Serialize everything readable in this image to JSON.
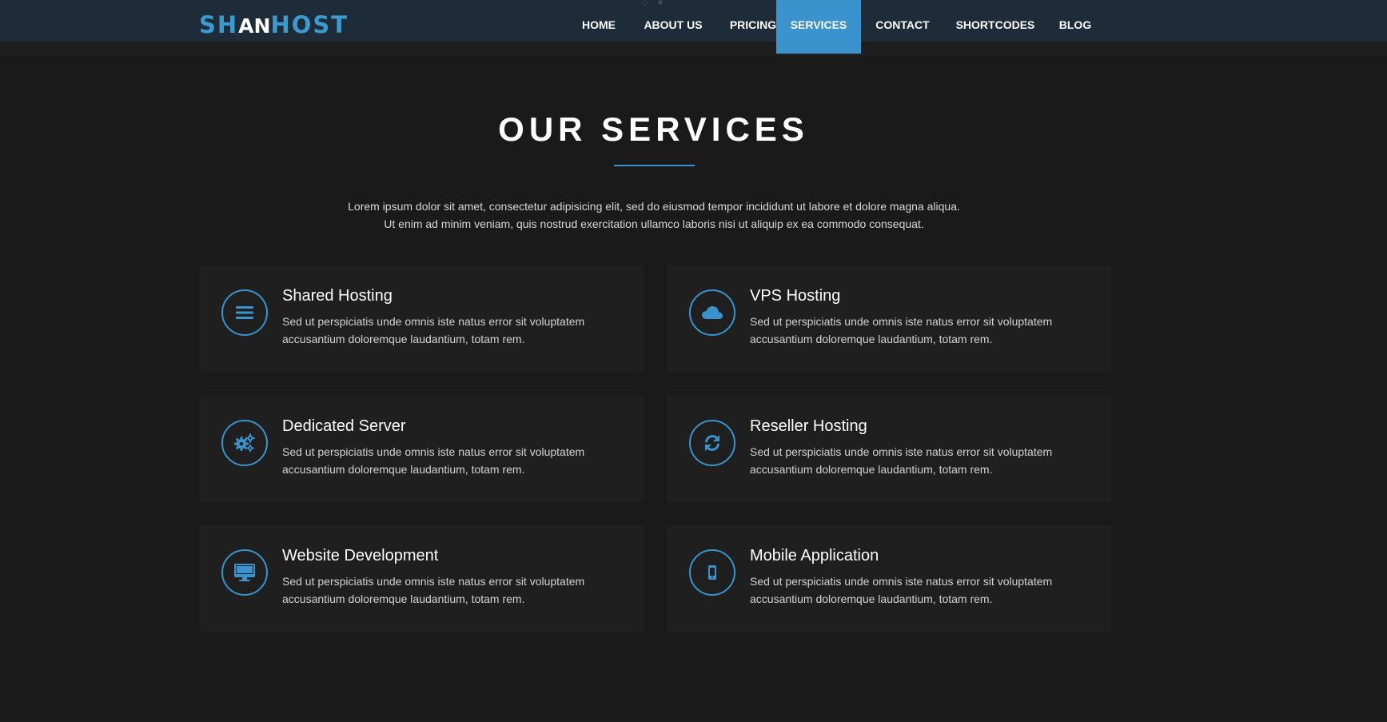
{
  "header": {
    "logo": {
      "part1": "SH",
      "part2": "AN",
      "part3": "HOST"
    },
    "nav": [
      {
        "label": "HOME",
        "active": false
      },
      {
        "label": "ABOUT US",
        "active": false
      },
      {
        "label": "PRICING",
        "active": false
      },
      {
        "label": "SERVICES",
        "active": true
      },
      {
        "label": "CONTACT",
        "active": false
      },
      {
        "label": "SHORTCODES",
        "active": false
      },
      {
        "label": "BLOG",
        "active": false
      }
    ]
  },
  "services": {
    "title": "OUR SERVICES",
    "intro_line1": "Lorem ipsum dolor sit amet, consectetur adipisicing elit, sed do eiusmod tempor incididunt ut labore et dolore magna aliqua.",
    "intro_line2": "Ut enim ad minim veniam, quis nostrud exercitation ullamco laboris nisi ut aliquip ex ea commodo consequat.",
    "items": [
      {
        "title": "Shared Hosting",
        "icon": "bars-icon",
        "text_line1": "Sed ut perspiciatis unde omnis iste natus error sit voluptatem",
        "text_line2": "accusantium doloremque laudantium, totam rem."
      },
      {
        "title": "VPS Hosting",
        "icon": "cloud-icon",
        "text_line1": "Sed ut perspiciatis unde omnis iste natus error sit voluptatem",
        "text_line2": "accusantium doloremque laudantium, totam rem."
      },
      {
        "title": "Dedicated Server",
        "icon": "gears-icon",
        "text_line1": "Sed ut perspiciatis unde omnis iste natus error sit voluptatem",
        "text_line2": "accusantium doloremque laudantium, totam rem."
      },
      {
        "title": "Reseller Hosting",
        "icon": "refresh-icon",
        "text_line1": "Sed ut perspiciatis unde omnis iste natus error sit voluptatem",
        "text_line2": "accusantium doloremque laudantium, totam rem."
      },
      {
        "title": "Website Development",
        "icon": "desktop-icon",
        "text_line1": "Sed ut perspiciatis unde omnis iste natus error sit voluptatem",
        "text_line2": "accusantium doloremque laudantium, totam rem."
      },
      {
        "title": "Mobile Application",
        "icon": "mobile-icon",
        "text_line1": "Sed ut perspiciatis unde omnis iste natus error sit voluptatem",
        "text_line2": "accusantium doloremque laudantium, totam rem."
      }
    ]
  },
  "colors": {
    "accent": "#3a93cc",
    "background": "#1a1a1a",
    "navbar": "#1e2b38",
    "card": "#1f1f1f"
  }
}
